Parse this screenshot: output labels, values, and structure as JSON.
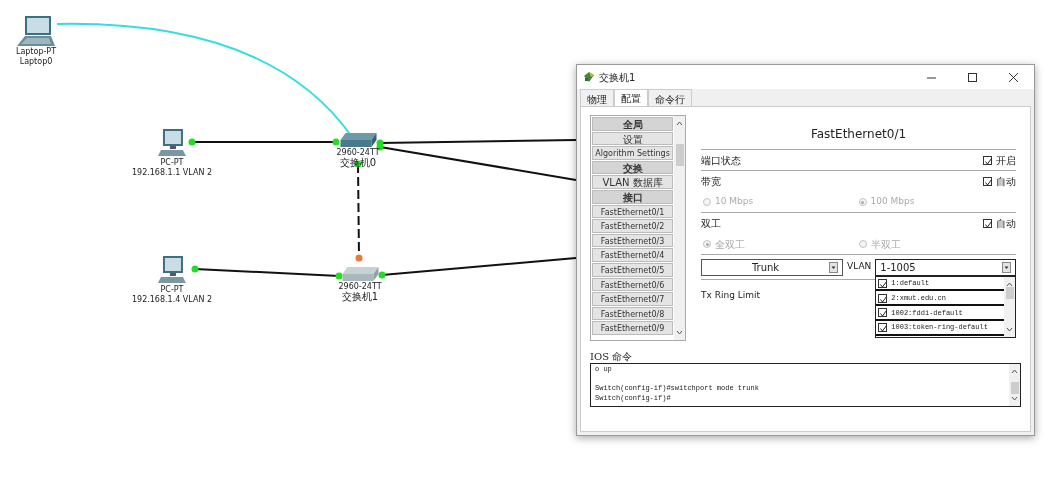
{
  "diagram": {
    "devices": [
      {
        "kind": "laptop",
        "model": "Laptop-PT",
        "name": "Laptop0"
      },
      {
        "kind": "pc",
        "model": "PC-PT",
        "name": "192.168.1.1 VLAN 2"
      },
      {
        "kind": "switch",
        "model": "2960-24TT",
        "name": "交换机0",
        "selected": true
      },
      {
        "kind": "pc",
        "model": "PC-PT",
        "name": "192.168.1.4  VLAN 2"
      },
      {
        "kind": "switch",
        "model": "2960-24TT",
        "name": "交换机1",
        "selected": false
      }
    ],
    "links": [
      {
        "kind": "console"
      },
      {
        "kind": "straight",
        "lights": [
          {
            "kind": "source",
            "color": "#22dd22"
          },
          {
            "kind": "target",
            "color": "#22dd22"
          }
        ]
      },
      {
        "kind": "straight",
        "lights": [
          {
            "kind": "source",
            "color": "#22dd22"
          }
        ]
      },
      {
        "kind": "straight",
        "lights": [
          {
            "kind": "source",
            "color": "#22dd22"
          }
        ]
      },
      {
        "kind": "crossover",
        "lights": [
          {
            "kind": "source",
            "color": "#22dd22"
          },
          {
            "kind": "target",
            "color": "#ee7733"
          }
        ]
      },
      {
        "kind": "straight",
        "lights": [
          {
            "kind": "source",
            "color": "#22dd22"
          },
          {
            "kind": "target",
            "color": "#22dd22"
          }
        ]
      },
      {
        "kind": "straight",
        "lights": [
          {
            "kind": "source",
            "color": "#22dd22"
          }
        ]
      }
    ]
  },
  "window": {
    "title": "交换机1",
    "tabs": [
      {
        "label": "物理",
        "selected": false
      },
      {
        "label": "配置",
        "selected": true
      },
      {
        "label": "命令行",
        "selected": false
      }
    ],
    "sidebar": {
      "items": [
        {
          "label": "全局",
          "kind": "header"
        },
        {
          "label": "设置",
          "kind": "item"
        },
        {
          "label": "Algorithm Settings",
          "kind": "item"
        },
        {
          "label": "交换",
          "kind": "header"
        },
        {
          "label": "VLAN 数据库",
          "kind": "item"
        },
        {
          "label": "接口",
          "kind": "header"
        },
        {
          "label": "FastEthernet0/1",
          "kind": "item"
        },
        {
          "label": "FastEthernet0/2",
          "kind": "item"
        },
        {
          "label": "FastEthernet0/3",
          "kind": "item"
        },
        {
          "label": "FastEthernet0/4",
          "kind": "item"
        },
        {
          "label": "FastEthernet0/5",
          "kind": "item"
        },
        {
          "label": "FastEthernet0/6",
          "kind": "item"
        },
        {
          "label": "FastEthernet0/7",
          "kind": "item"
        },
        {
          "label": "FastEthernet0/8",
          "kind": "item"
        },
        {
          "label": "FastEthernet0/9",
          "kind": "item"
        }
      ]
    },
    "panel": {
      "title": "FastEthernet0/1",
      "port_status": {
        "label": "端口状态",
        "checkbox_label": "开启",
        "checked": true
      },
      "bandwidth": {
        "label": "带宽",
        "checkbox_label": "自动",
        "checked": true,
        "options": [
          {
            "label": "10 Mbps",
            "selected": false,
            "disabled": true
          },
          {
            "label": "100 Mbps",
            "selected": true,
            "disabled": true
          }
        ]
      },
      "duplex": {
        "label": "双工",
        "checkbox_label": "自动",
        "checked": true,
        "options": [
          {
            "label": "全双工",
            "selected": true,
            "disabled": true
          },
          {
            "label": "半双工",
            "selected": false,
            "disabled": true
          }
        ]
      },
      "mode": {
        "value": "Trunk"
      },
      "vlan": {
        "label": "VLAN",
        "value": "1-1005",
        "expanded": true,
        "items": [
          {
            "label": "1:default",
            "checked": true
          },
          {
            "label": "2:xmut.edu.cn",
            "checked": true
          },
          {
            "label": "1002:fddi-default",
            "checked": true
          },
          {
            "label": "1003:token-ring-default",
            "checked": true
          }
        ]
      },
      "tx_ring_limit": {
        "label": "Tx Ring Limit"
      }
    },
    "ios": {
      "title": "IOS 命令",
      "text": "o up\n\nSwitch(config-if)#switchport mode trunk\nSwitch(config-if)#"
    }
  }
}
